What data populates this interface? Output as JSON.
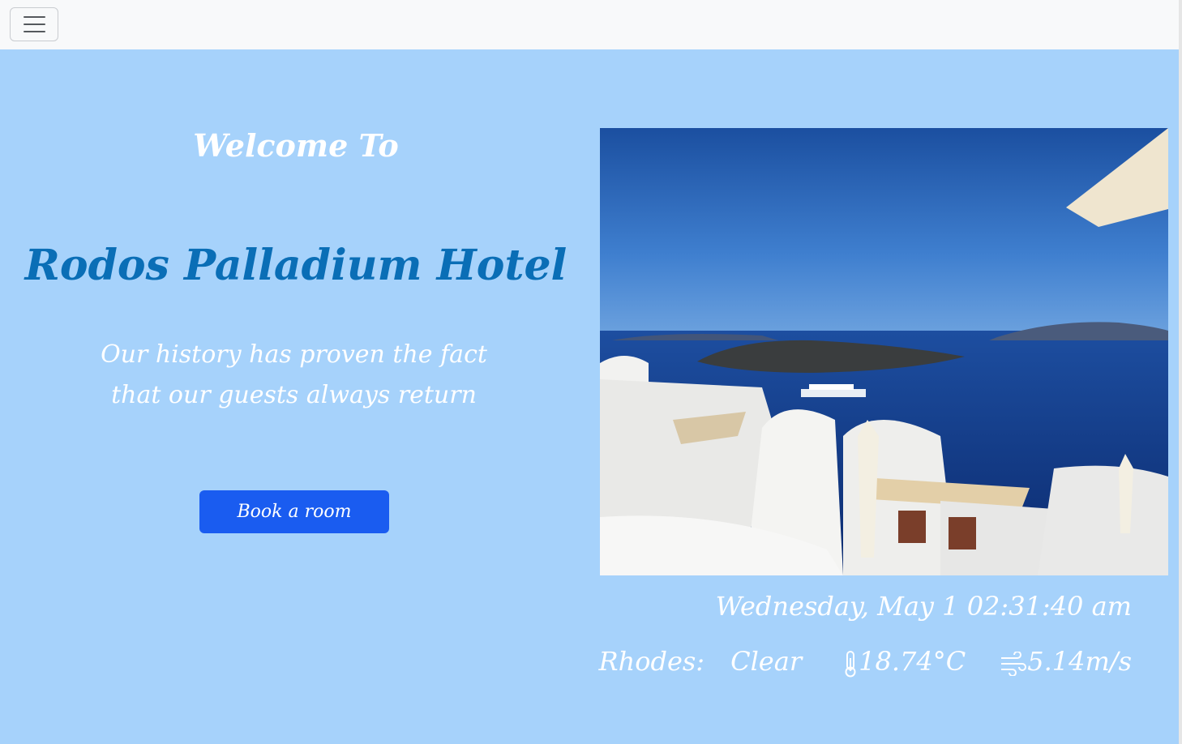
{
  "navbar": {
    "toggler_icon": "hamburger-menu-icon"
  },
  "hero": {
    "welcome": "Welcome To",
    "hotel_name": "Rodos Palladium Hotel",
    "tagline_line1": "Our history has proven the fact",
    "tagline_line2": "that our guests always return",
    "book_button": "Book a room"
  },
  "info": {
    "datetime": "Wednesday, May 1 02:31:40 am",
    "city": "Rhodes:",
    "condition": "Clear",
    "temperature": "18.74°C",
    "wind": "5.14m/s",
    "temperature_icon": "thermometer-icon",
    "wind_icon": "wind-icon"
  },
  "colors": {
    "background": "#a6d2fb",
    "navbar": "#f8f9fa",
    "hotel_name": "#0a6eb6",
    "button": "#1a5cf0"
  }
}
